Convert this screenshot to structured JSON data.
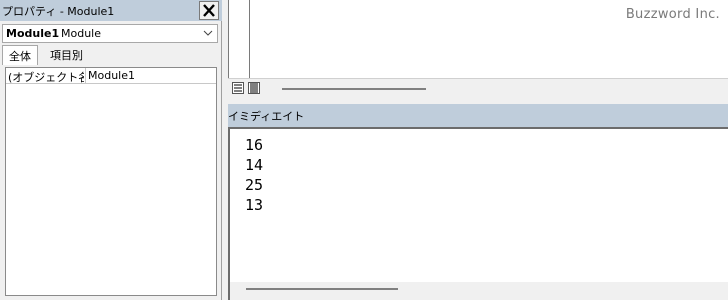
{
  "properties": {
    "title": "プロパティ - Module1",
    "object_name": "Module1",
    "object_type": "Module",
    "tabs": [
      "全体",
      "項目別"
    ],
    "rows": [
      {
        "key": "(オブジェクト名)",
        "value": "Module1"
      }
    ]
  },
  "watermark": "Buzzword Inc.",
  "immediate": {
    "title": "イミディエイト",
    "lines": [
      "16",
      "14",
      "25",
      "13"
    ]
  }
}
